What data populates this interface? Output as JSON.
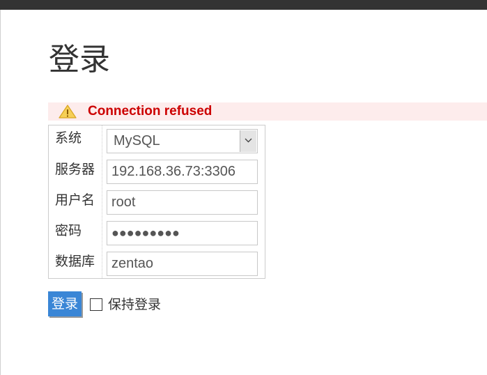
{
  "page": {
    "title": "登录"
  },
  "error": {
    "message": "Connection refused",
    "icon": "warning-icon",
    "color": "#cc0000",
    "background": "#fdecec"
  },
  "form": {
    "system_label": "系统",
    "system_value": "MySQL",
    "server_label": "服务器",
    "server_value": "192.168.36.73:3306",
    "username_label": "用户名",
    "username_value": "root",
    "password_label": "密码",
    "password_value": "●●●●●●●●●",
    "database_label": "数据库",
    "database_value": "zentao"
  },
  "actions": {
    "login_label": "登录",
    "remember_label": "保持登录",
    "remember_checked": false,
    "button_color": "#3a86d6"
  }
}
